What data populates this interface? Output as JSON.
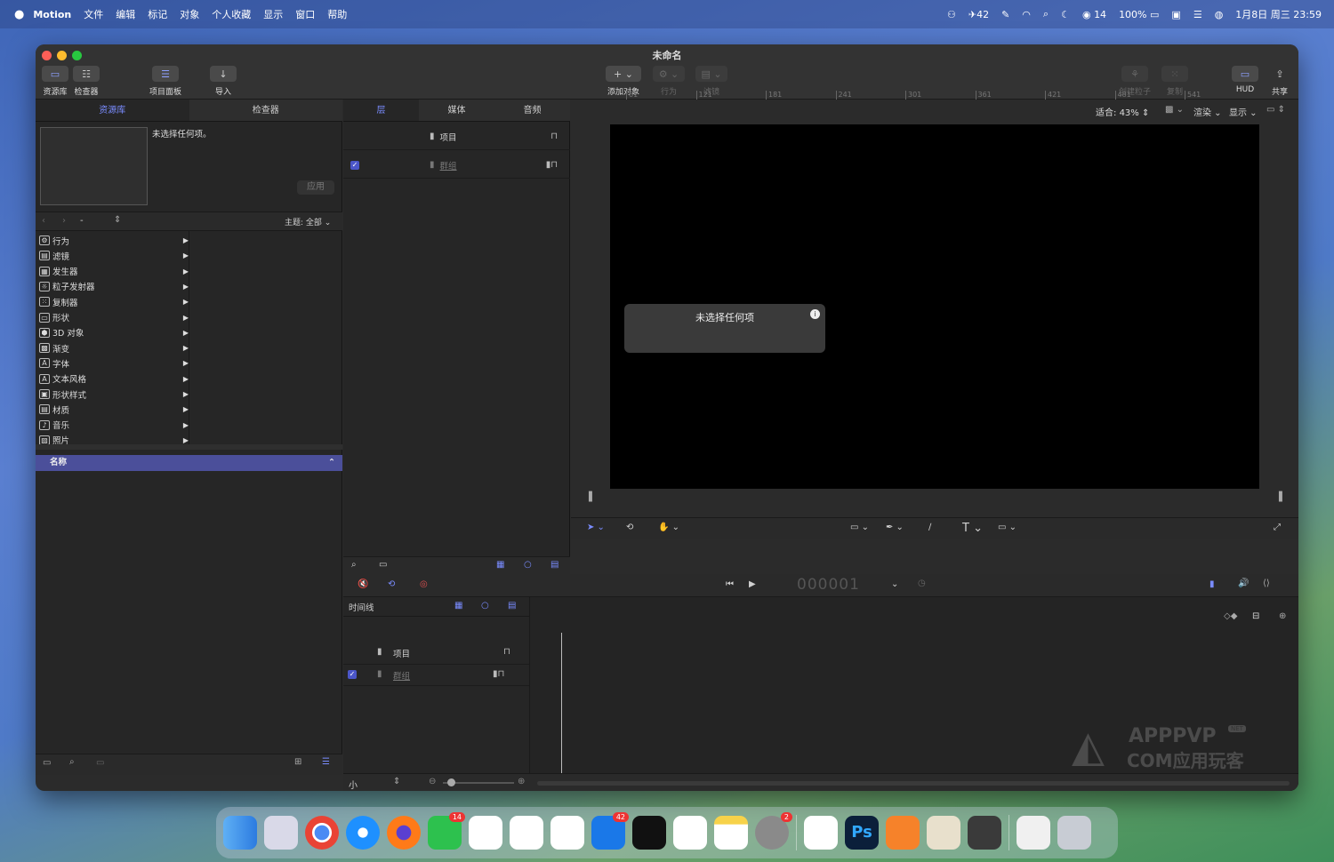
{
  "menubar": {
    "app": "Motion",
    "items": [
      "文件",
      "编辑",
      "标记",
      "对象",
      "个人收藏",
      "显示",
      "窗口",
      "帮助"
    ],
    "status": {
      "battery_badge": "42",
      "wechat_count": "14",
      "battery": "100%",
      "datetime": "1月8日 周三 23:59"
    }
  },
  "window": {
    "title": "未命名",
    "toolbar": {
      "library": "资源库",
      "inspector": "检查器",
      "project_panel": "项目面板",
      "import": "导入",
      "add_object": "添加对象",
      "behavior": "行为",
      "filter": "滤镜",
      "create_particles": "创建粒子",
      "replicate": "复制",
      "hud": "HUD",
      "share": "共享"
    }
  },
  "left_panel": {
    "tabs": [
      "资源库",
      "检查器"
    ],
    "preview_text": "未选择任何项。",
    "apply": "应用",
    "path": "-",
    "theme": "主题: 全部",
    "categories": [
      "行为",
      "滤镜",
      "发生器",
      "粒子发射器",
      "复制器",
      "形状",
      "3D 对象",
      "渐变",
      "字体",
      "文本风格",
      "形状样式",
      "材质",
      "音乐",
      "照片"
    ],
    "list_header": "名称"
  },
  "mid_panel": {
    "tabs": [
      "层",
      "媒体",
      "音频"
    ],
    "rows": [
      {
        "name": "项目"
      },
      {
        "name": "群组"
      }
    ]
  },
  "viewer": {
    "fit_label": "适合:",
    "zoom": "43%",
    "render": "渲染",
    "view": "显示",
    "hud_title": "未选择任何项"
  },
  "transport": {
    "timecode": "000001"
  },
  "timeline": {
    "label": "时间线",
    "rows": [
      {
        "name": "项目"
      },
      {
        "name": "群组"
      }
    ],
    "ticks": [
      "61",
      "121",
      "181",
      "241",
      "301",
      "361",
      "421",
      "481",
      "541"
    ],
    "size": "小"
  },
  "watermark": {
    "line1": "APPPVP",
    "line2": "COM应用玩客",
    "tag": "NET"
  },
  "dock": {
    "badges": {
      "wechat": "14",
      "mail": "42",
      "settings": "2"
    }
  }
}
